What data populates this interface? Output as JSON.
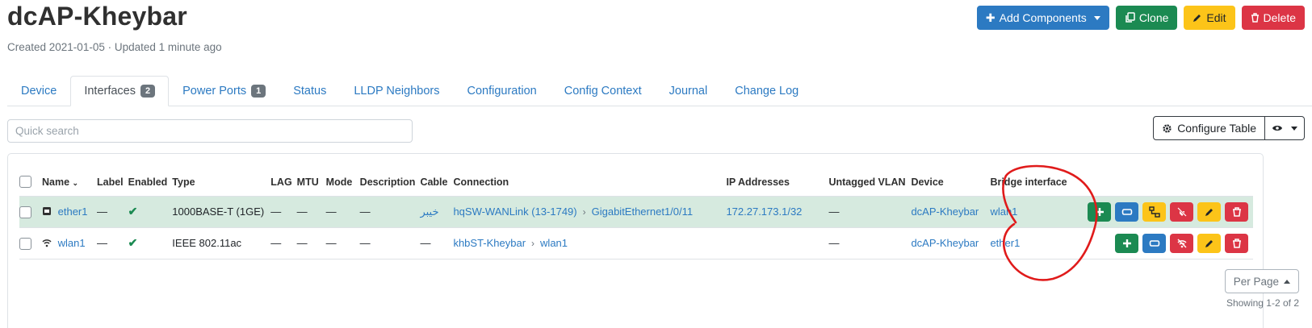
{
  "header": {
    "title": "dcAP-Kheybar",
    "subtitle": "Created 2021-01-05 · Updated 1 minute ago",
    "actions": {
      "add_components": "Add Components",
      "clone": "Clone",
      "edit": "Edit",
      "delete": "Delete"
    }
  },
  "tabs": [
    {
      "label": "Device"
    },
    {
      "label": "Interfaces",
      "badge": "2",
      "active": true
    },
    {
      "label": "Power Ports",
      "badge": "1"
    },
    {
      "label": "Status"
    },
    {
      "label": "LLDP Neighbors"
    },
    {
      "label": "Configuration"
    },
    {
      "label": "Config Context"
    },
    {
      "label": "Journal"
    },
    {
      "label": "Change Log"
    }
  ],
  "search": {
    "placeholder": "Quick search",
    "value": ""
  },
  "table_tools": {
    "configure_label": "Configure Table"
  },
  "table": {
    "columns": [
      "Name",
      "Label",
      "Enabled",
      "Type",
      "LAG",
      "MTU",
      "Mode",
      "Description",
      "Cable",
      "Connection",
      "IP Addresses",
      "Untagged VLAN",
      "Device",
      "Bridge interface"
    ],
    "rows": [
      {
        "name": "ether1",
        "label": "—",
        "enabled": "✔",
        "type": "1000BASE-T (1GE)",
        "lag": "—",
        "mtu": "—",
        "mode": "—",
        "description": "—",
        "cable": "خیبر",
        "connection_device": "hqSW-WANLink (13-1749)",
        "connection_sep": "›",
        "connection_port": "GigabitEthernet1/0/11",
        "ip_addresses": "172.27.173.1/32",
        "untagged_vlan": "—",
        "device": "dcAP-Kheybar",
        "bridge_interface": "wlan1"
      },
      {
        "name": "wlan1",
        "label": "—",
        "enabled": "✔",
        "type": "IEEE 802.11ac",
        "lag": "—",
        "mtu": "—",
        "mode": "—",
        "description": "—",
        "cable": "—",
        "connection_device": "khbST-Kheybar",
        "connection_sep": "›",
        "connection_port": "wlan1",
        "ip_addresses": "",
        "untagged_vlan": "—",
        "device": "dcAP-Kheybar",
        "bridge_interface": "ether1"
      }
    ]
  },
  "pagination": {
    "per_page_label": "Per Page",
    "showing": "Showing 1-2 of 2"
  },
  "colors": {
    "primary": "#2c7ac2",
    "success": "#1b8a52",
    "warning": "#fcc419",
    "danger": "#dc3545",
    "row_highlight": "#d6eadf",
    "annotation": "#e01b1b"
  }
}
